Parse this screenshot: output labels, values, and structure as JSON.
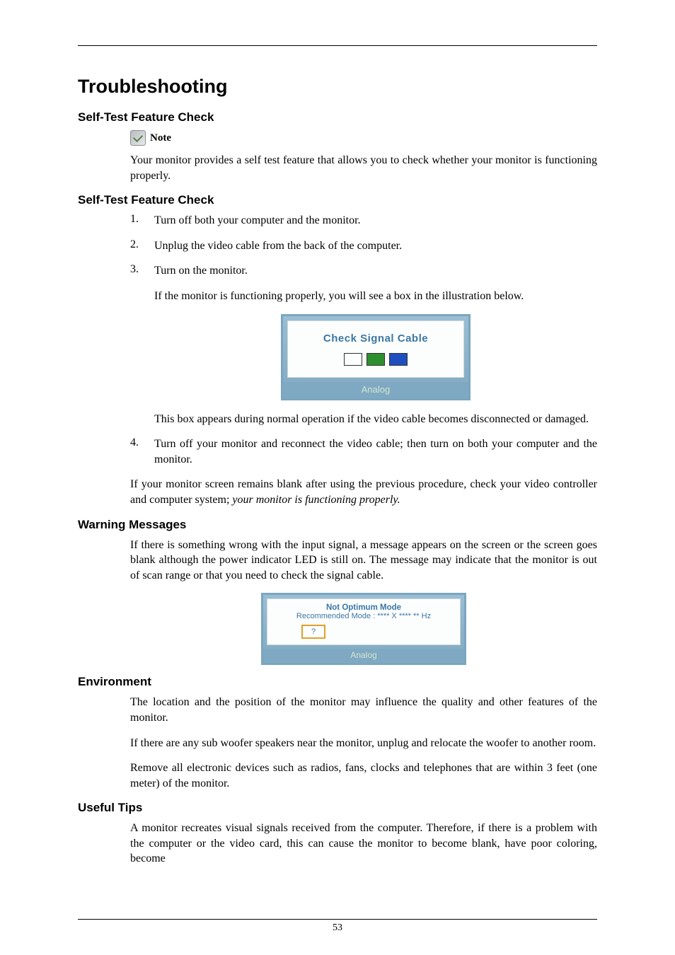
{
  "chapter_title": "Troubleshooting",
  "sections": {
    "self_test_intro": {
      "heading": "Self-Test Feature Check",
      "note_label": "Note",
      "note_body": "Your monitor provides a self test feature that allows you to check whether your monitor is functioning properly."
    },
    "self_test_steps": {
      "heading": "Self-Test Feature Check",
      "steps": {
        "s1": "Turn off both your computer and the monitor.",
        "s2": "Unplug the video cable from the back of the computer.",
        "s3": "Turn on the monitor.",
        "s3_after": "If the monitor is functioning properly, you will see a box in the illustration below.",
        "s3_box_caption": "This box appears during normal operation if the video cable becomes disconnected or damaged.",
        "s4": "Turn off your monitor and reconnect the video cable; then turn on both your computer and the monitor."
      },
      "closing_plain": "If your monitor screen remains blank after using the previous procedure, check your video controller and computer system; ",
      "closing_italic": "your monitor is functioning properly."
    },
    "warning": {
      "heading": "Warning Messages",
      "body": "If there is something wrong with the input signal, a message appears on the screen or the screen goes blank although the power indicator LED is still on. The message may indicate that the monitor is out of scan range or that you need to check the signal cable."
    },
    "environment": {
      "heading": "Environment",
      "p1": "The location and the position of the monitor may influence the quality and other features of the monitor.",
      "p2": "If there are any sub woofer speakers near the monitor, unplug and relocate the woofer to another room.",
      "p3": "Remove all electronic devices such as radios, fans, clocks and telephones that are within 3 feet (one meter) of the monitor."
    },
    "tips": {
      "heading": "Useful Tips",
      "p1": "A monitor recreates visual signals received from the computer. Therefore, if there is a problem with the computer or the video card, this can cause the monitor to become blank, have poor coloring, become"
    }
  },
  "figure1": {
    "title": "Check Signal Cable",
    "colors": {
      "red": "#d71f1f",
      "green": "#2e8f2e",
      "blue": "#1f4fbf"
    },
    "footer": "Analog"
  },
  "figure2": {
    "line1": "Not Optimum Mode",
    "line2": "Recommended Mode : **** X **** ** Hz",
    "qmark": "?",
    "footer": "Analog"
  },
  "page_number": "53"
}
